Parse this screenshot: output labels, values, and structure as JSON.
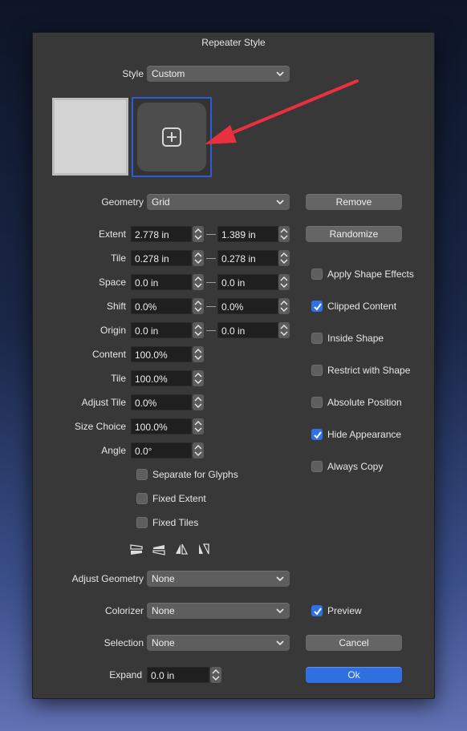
{
  "window": {
    "title": "Repeater Style"
  },
  "style": {
    "label": "Style",
    "value": "Custom"
  },
  "thumbnails": {
    "add_icon": "plus-square-icon",
    "arrow_color": "#e8303f"
  },
  "geometry": {
    "label": "Geometry",
    "value": "Grid"
  },
  "rows": {
    "extent": {
      "label": "Extent",
      "v1": "2.778 in",
      "v2": "1.389 in"
    },
    "tile": {
      "label": "Tile",
      "v1": "0.278 in",
      "v2": "0.278 in"
    },
    "space": {
      "label": "Space",
      "v1": "0.0 in",
      "v2": "0.0 in"
    },
    "shift": {
      "label": "Shift",
      "v1": "0.0%",
      "v2": "0.0%"
    },
    "origin": {
      "label": "Origin",
      "v1": "0.0 in",
      "v2": "0.0 in"
    },
    "content": {
      "label": "Content",
      "v1": "100.0%"
    },
    "tile2": {
      "label": "Tile",
      "v1": "100.0%"
    },
    "adjust_tile": {
      "label": "Adjust Tile",
      "v1": "0.0%"
    },
    "size_choice": {
      "label": "Size Choice",
      "v1": "100.0%"
    },
    "angle": {
      "label": "Angle",
      "v1": "0.0°"
    }
  },
  "left_checks": [
    {
      "label": "Separate for Glyphs",
      "checked": false
    },
    {
      "label": "Fixed Extent",
      "checked": false
    },
    {
      "label": "Fixed Tiles",
      "checked": false
    }
  ],
  "right_buttons": {
    "remove": "Remove",
    "randomize": "Randomize"
  },
  "right_checks": [
    {
      "label": "Apply Shape Effects",
      "checked": false
    },
    {
      "label": "Clipped Content",
      "checked": true
    },
    {
      "label": "Inside Shape",
      "checked": false
    },
    {
      "label": "Restrict with Shape",
      "checked": false
    },
    {
      "label": "Absolute Position",
      "checked": false
    },
    {
      "label": "Hide Appearance",
      "checked": true
    },
    {
      "label": "Always Copy",
      "checked": false
    }
  ],
  "transform_icons": [
    "flip-bottom-icon",
    "flip-top-icon",
    "flip-horizontal-icon",
    "skew-icon"
  ],
  "adjust_geometry": {
    "label": "Adjust Geometry",
    "value": "None"
  },
  "colorizer": {
    "label": "Colorizer",
    "value": "None"
  },
  "selection": {
    "label": "Selection",
    "value": "None"
  },
  "expand": {
    "label": "Expand",
    "value": "0.0 in"
  },
  "preview": {
    "label": "Preview",
    "checked": true
  },
  "footer": {
    "cancel": "Cancel",
    "ok": "Ok"
  },
  "colors": {
    "accent": "#2f6fe0",
    "panel": "#383838",
    "field": "#1f1f1f"
  }
}
